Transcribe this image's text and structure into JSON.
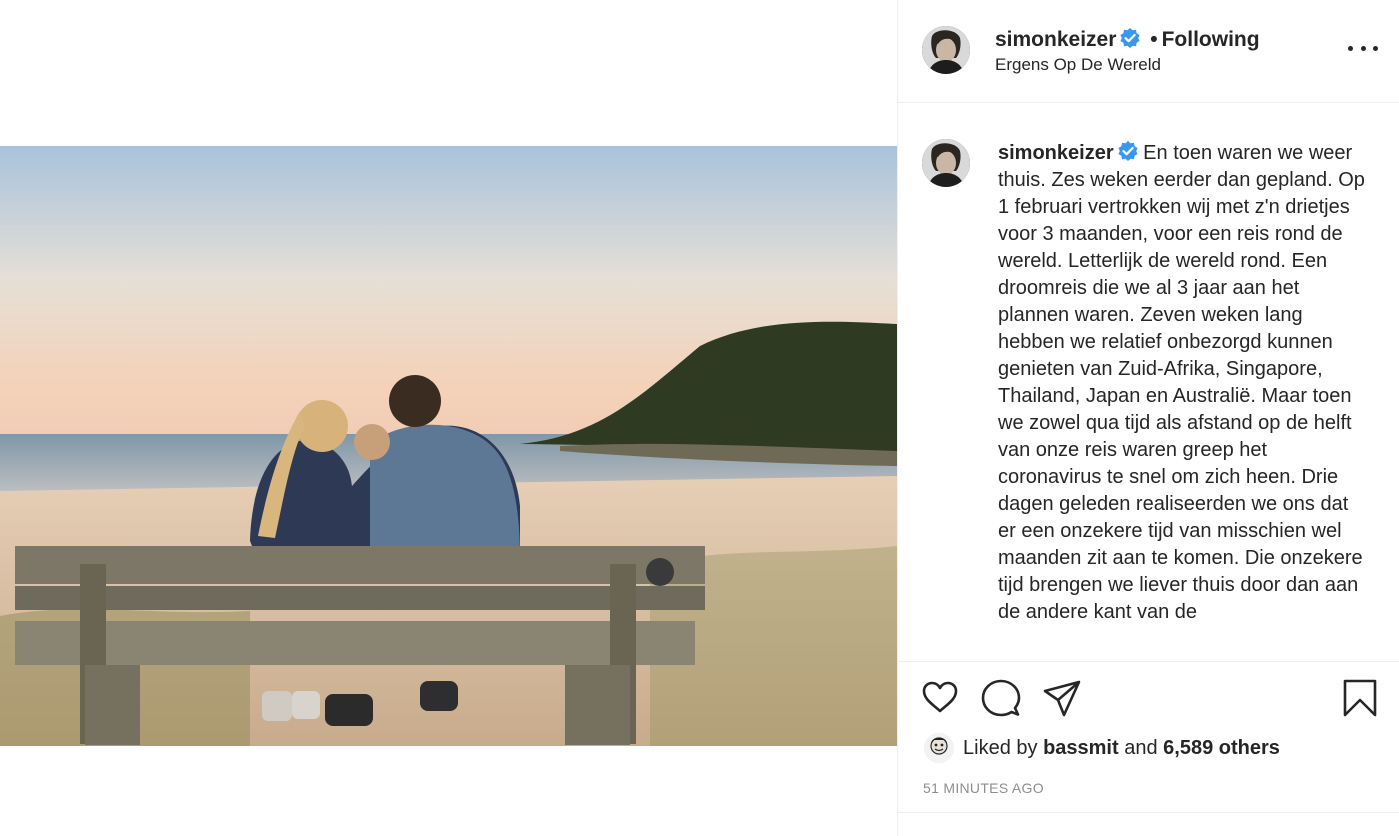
{
  "post": {
    "username": "simonkeizer",
    "separator": "•",
    "follow_status": "Following",
    "location": "Ergens Op De Wereld",
    "caption": "En toen waren we weer thuis. Zes weken eerder dan gepland. Op 1 februari vertrokken wij met z'n drietjes voor 3 maanden, voor een reis rond de wereld. Letterlijk de wereld rond. Een droomreis die we al 3 jaar aan het plannen waren. Zeven weken lang hebben we relatief onbezorgd kunnen genieten van Zuid-Afrika, Singapore, Thailand, Japan en Australië. Maar toen we zowel qua tijd als afstand op de helft van onze reis waren greep het coronavirus te snel om zich heen. Drie dagen geleden realiseerden we ons dat er een onzekere tijd van misschien wel maanden zit aan te komen. Die onzekere tijd brengen we liever thuis door dan aan de andere kant van de",
    "likes": {
      "prefix": "Liked by",
      "user": "bassmit",
      "and": "and",
      "others": "6,589 others"
    },
    "timestamp": "51 MINUTES AGO"
  },
  "icons": {
    "verified": "verified-badge-icon",
    "more": "more-options-icon",
    "like": "heart-icon",
    "comment": "comment-icon",
    "share": "share-icon",
    "save": "bookmark-icon"
  },
  "colors": {
    "verified": "#3897f0",
    "text": "#262626",
    "muted": "#8e8e8e",
    "border": "#efefef"
  }
}
